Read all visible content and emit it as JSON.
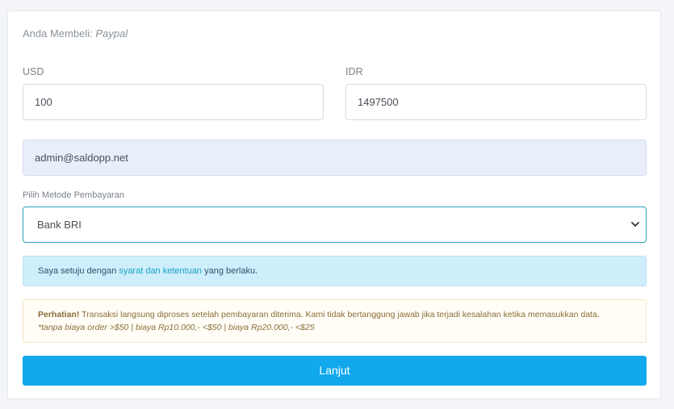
{
  "header": {
    "buying_label": "Anda Membeli:",
    "product": "Paypal"
  },
  "form": {
    "usd": {
      "label": "USD",
      "value": "100"
    },
    "idr": {
      "label": "IDR",
      "value": "1497500"
    },
    "email": {
      "value": "admin@saldopp.net"
    },
    "payment": {
      "label": "Pilih Metode Pembayaran",
      "selected": "Bank BRI"
    }
  },
  "agreement": {
    "before": "Saya setuju dengan ",
    "link": "syarat dan ketentuan",
    "after": " yang berlaku."
  },
  "warning": {
    "title": "Perhatian!",
    "text": " Transaksi langsung diproses setelah pembayaran diterima. Kami tidak bertanggung jawab jika terjadi kesalahan ketika memasukkan data.",
    "note": "*tanpa biaya order >$50 | biaya Rp10.000,- <$50 | biaya Rp20.000,- <$25"
  },
  "submit": {
    "label": "Lanjut"
  },
  "colors": {
    "accent": "#12a9ec",
    "select_border": "#2aa3b8",
    "info_bg": "#cfeefb"
  },
  "icons": {
    "select_arrow": "chevron-down-icon"
  }
}
